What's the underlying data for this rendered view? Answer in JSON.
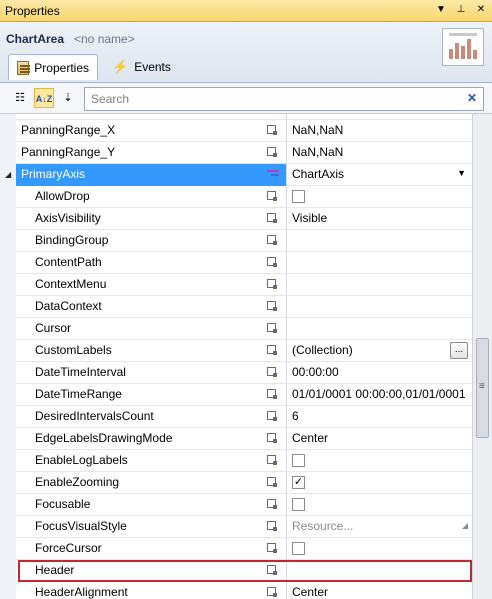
{
  "window": {
    "title": "Properties"
  },
  "header": {
    "object_type": "ChartArea",
    "object_name": "<no name>",
    "tabs": [
      {
        "label": "Properties",
        "icon": "properties-icon",
        "active": true
      },
      {
        "label": "Events",
        "icon": "lightning-bolt-icon",
        "active": false
      }
    ]
  },
  "toolbar": {
    "search_placeholder": "Search",
    "sort_mode": "alphabetical"
  },
  "rows": [
    {
      "name": "PanningRange_X",
      "value": "NaN,NaN",
      "child": false
    },
    {
      "name": "PanningRange_Y",
      "value": "NaN,NaN",
      "child": false
    },
    {
      "name": "PrimaryAxis",
      "value": "ChartAxis",
      "child": false,
      "selected": true
    },
    {
      "name": "AllowDrop",
      "value": "",
      "child": true,
      "checkbox": false
    },
    {
      "name": "AxisVisibility",
      "value": "Visible",
      "child": true
    },
    {
      "name": "BindingGroup",
      "value": "",
      "child": true
    },
    {
      "name": "ContentPath",
      "value": "",
      "child": true
    },
    {
      "name": "ContextMenu",
      "value": "",
      "child": true
    },
    {
      "name": "DataContext",
      "value": "",
      "child": true
    },
    {
      "name": "Cursor",
      "value": "",
      "child": true
    },
    {
      "name": "CustomLabels",
      "value": "(Collection)",
      "child": true
    },
    {
      "name": "DateTimeInterval",
      "value": "00:00:00",
      "child": true
    },
    {
      "name": "DateTimeRange",
      "value": "01/01/0001 00:00:00,01/01/0001",
      "child": true
    },
    {
      "name": "DesiredIntervalsCount",
      "value": "6",
      "child": true
    },
    {
      "name": "EdgeLabelsDrawingMode",
      "value": "Center",
      "child": true
    },
    {
      "name": "EnableLogLabels",
      "value": "",
      "child": true,
      "checkbox": false
    },
    {
      "name": "EnableZooming",
      "value": "",
      "child": true,
      "checkbox": true
    },
    {
      "name": "Focusable",
      "value": "",
      "child": true,
      "checkbox": false
    },
    {
      "name": "FocusVisualStyle",
      "value": "Resource...",
      "child": true
    },
    {
      "name": "ForceCursor",
      "value": "",
      "child": true,
      "checkbox": false
    },
    {
      "name": "Header",
      "value": "",
      "child": true,
      "highlighted": true
    },
    {
      "name": "HeaderAlignment",
      "value": "Center",
      "child": true
    }
  ]
}
